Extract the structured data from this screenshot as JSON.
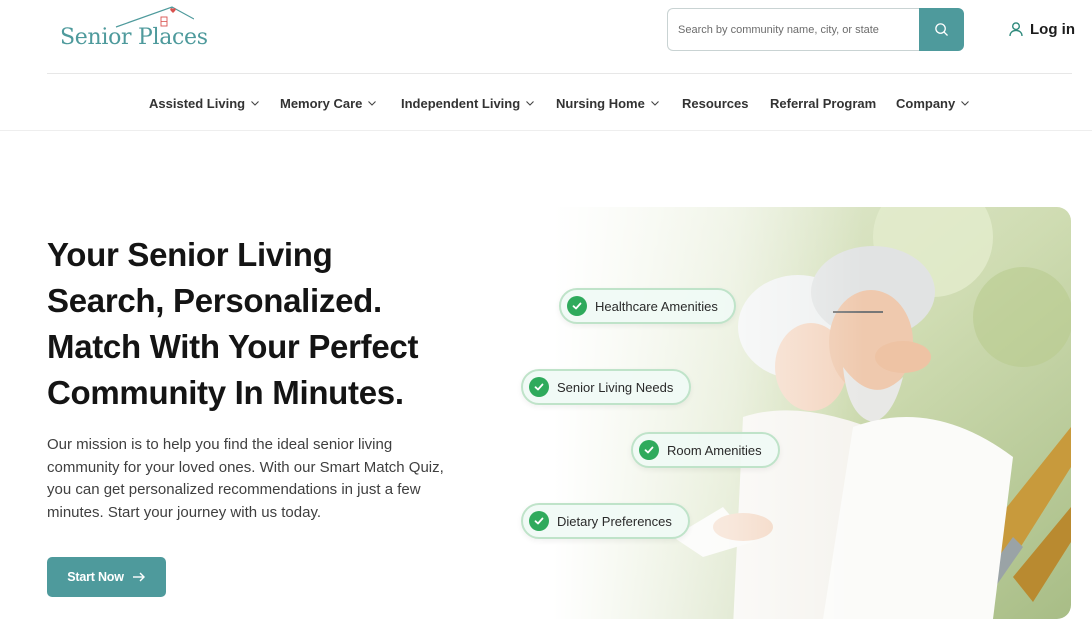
{
  "brand": {
    "name": "Senior Places"
  },
  "search": {
    "placeholder": "Search by community name, city, or state"
  },
  "login": {
    "label": "Log in"
  },
  "nav": [
    {
      "label": "Assisted Living",
      "dropdown": true
    },
    {
      "label": "Memory Care",
      "dropdown": true
    },
    {
      "label": "Independent Living",
      "dropdown": true
    },
    {
      "label": "Nursing Home",
      "dropdown": true
    },
    {
      "label": "Resources",
      "dropdown": false
    },
    {
      "label": "Referral Program",
      "dropdown": false
    },
    {
      "label": "Company",
      "dropdown": true
    }
  ],
  "hero": {
    "title_lines": [
      "Your Senior Living",
      "Search, Personalized.",
      "Match With Your Perfect",
      "Community In Minutes."
    ],
    "description_lines": [
      "Our mission is to help you find the ideal senior living",
      "community for your loved ones. With our Smart Match Quiz,",
      "you can get personalized recommendations in just a few",
      "minutes. Start your journey with us today."
    ],
    "cta_label": "Start Now"
  },
  "chips": [
    "Healthcare Amenities",
    "Senior Living Needs",
    "Room Amenities",
    "Dietary Preferences"
  ],
  "colors": {
    "brand": "#4e9a9c",
    "check": "#2faa5c",
    "logo_heart": "#d9534f"
  },
  "icons": [
    "search-icon",
    "user-icon",
    "chevron-down-icon",
    "arrow-right-icon",
    "check-icon",
    "house-roof-icon"
  ]
}
